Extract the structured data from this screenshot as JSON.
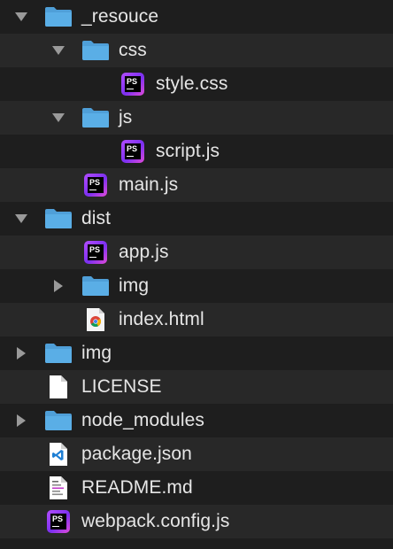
{
  "tree": {
    "items": [
      {
        "label": "_resouce",
        "type": "folder",
        "expanded": true,
        "icon": "folder-icon"
      },
      {
        "label": "css",
        "type": "folder",
        "expanded": true,
        "icon": "folder-icon"
      },
      {
        "label": "style.css",
        "type": "file",
        "icon": "phpstorm-file-icon"
      },
      {
        "label": "js",
        "type": "folder",
        "expanded": true,
        "icon": "folder-icon"
      },
      {
        "label": "script.js",
        "type": "file",
        "icon": "phpstorm-file-icon"
      },
      {
        "label": "main.js",
        "type": "file",
        "icon": "phpstorm-file-icon"
      },
      {
        "label": "dist",
        "type": "folder",
        "expanded": true,
        "icon": "folder-icon"
      },
      {
        "label": "app.js",
        "type": "file",
        "icon": "phpstorm-file-icon"
      },
      {
        "label": "img",
        "type": "folder",
        "expanded": false,
        "icon": "folder-icon"
      },
      {
        "label": "index.html",
        "type": "file",
        "icon": "chrome-html-file-icon"
      },
      {
        "label": "img",
        "type": "folder",
        "expanded": false,
        "icon": "folder-icon"
      },
      {
        "label": "LICENSE",
        "type": "file",
        "icon": "blank-document-icon"
      },
      {
        "label": "node_modules",
        "type": "folder",
        "expanded": false,
        "icon": "folder-icon"
      },
      {
        "label": "package.json",
        "type": "file",
        "icon": "vscode-file-icon"
      },
      {
        "label": "README.md",
        "type": "file",
        "icon": "text-document-icon"
      },
      {
        "label": "webpack.config.js",
        "type": "file",
        "icon": "phpstorm-file-icon"
      }
    ]
  },
  "colors": {
    "background": "#1e1e1e",
    "stripe": "#282828",
    "folder": "#5aaee6",
    "text": "#e6e6e6",
    "disclosure": "#9a9a9a"
  }
}
